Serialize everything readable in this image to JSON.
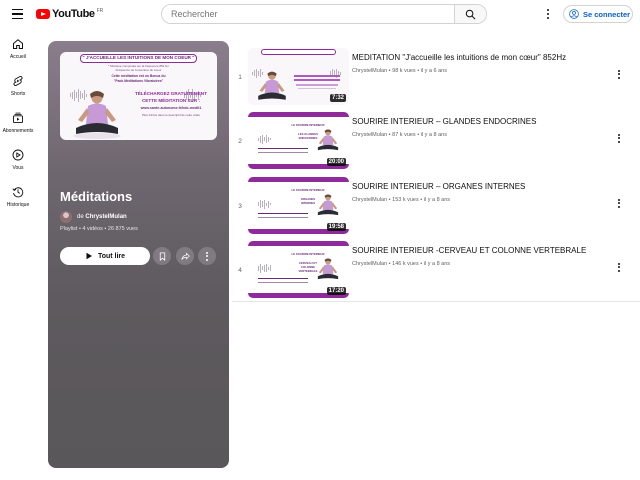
{
  "header": {
    "logo_text": "YouTube",
    "country_code": "FR",
    "search_placeholder": "Rechercher",
    "signin_label": "Se connecter"
  },
  "guide": [
    {
      "label": "Accueil",
      "icon": "home-icon"
    },
    {
      "label": "Shorts",
      "icon": "shorts-icon"
    },
    {
      "label": "Abonnements",
      "icon": "subscriptions-icon"
    },
    {
      "label": "Vous",
      "icon": "you-icon"
    },
    {
      "label": "Historique",
      "icon": "history-icon"
    }
  ],
  "playlist": {
    "title": "Méditations",
    "owner_prefix": "de",
    "owner": "ChrystelMulan",
    "type": "Playlist",
    "video_count": "4 vidéos",
    "views": "26 875 vues",
    "play_all_label": "Tout lire",
    "cover_text": {
      "line1": "\" J'ACCUEILLE LES INTUITIONS DE MON COEUR \"",
      "line2": "* Musique composée sur la fréquence 852 Hz",
      "line3": "Fréquence de l'ouverture du coeur",
      "line4": "Cette méditation est un Bonus du",
      "line5": "\"Pack Méditations Vibratoires\"",
      "line6": "TÉLÉCHARGEZ GRATUITEMENT",
      "line7": "CETTE MÉDITATION SUR :",
      "line8": "www.sante-autonome.fr/kdo-medit1",
      "line9": "Plus d'infos dans le descriptif de cette vidéo"
    }
  },
  "videos": [
    {
      "index": "1",
      "title": "MEDITATION \"J'accueille les intuitions de mon cœur\" 852Hz",
      "channel": "ChrystelMulan",
      "views": "98 k vues",
      "age": "il y a 6 ans",
      "duration": "7:32",
      "style": "a"
    },
    {
      "index": "2",
      "title": "SOURIRE INTERIEUR – GLANDES ENDOCRINES",
      "channel": "ChrystelMulan",
      "views": "87 k vues",
      "age": "il y a 8 ans",
      "duration": "20:00",
      "style": "b",
      "thumb_line1": "LE SOURIRE INTERIEUR",
      "thumb_line2": "LES GLANDES",
      "thumb_line3": "ENDOCRINES"
    },
    {
      "index": "3",
      "title": "SOURIRE INTERIEUR – ORGANES INTERNES",
      "channel": "ChrystelMulan",
      "views": "153 k vues",
      "age": "il y a 8 ans",
      "duration": "19:58",
      "style": "b",
      "thumb_line1": "LE SOURIRE INTERIEUR",
      "thumb_line2": "ORGANES",
      "thumb_line3": "INTERNES"
    },
    {
      "index": "4",
      "title": "SOURIRE INTERIEUR -CERVEAU ET COLONNE VERTEBRALE",
      "channel": "ChrystelMulan",
      "views": "146 k vues",
      "age": "il y a 8 ans",
      "duration": "17:20",
      "style": "b",
      "thumb_line1": "LE SOURIRE INTERIEUR",
      "thumb_line2": "CERVEAU ET",
      "thumb_line3": "COLONNE",
      "thumb_line4": "VERTEBRALE"
    }
  ],
  "colors": {
    "brand_red": "#ff0000",
    "link_blue": "#065fd4",
    "thumb_purple": "#8e2a9a"
  }
}
